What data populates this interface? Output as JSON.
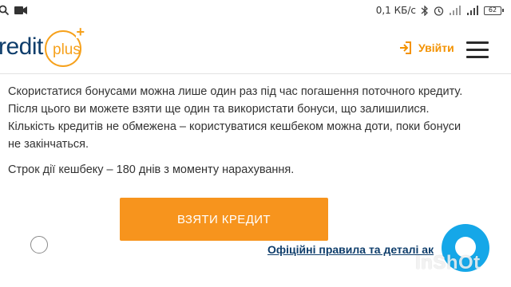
{
  "status_bar": {
    "network_speed": "0,1 КБ/с",
    "battery_level": "62",
    "icons": [
      "search-icon",
      "video-icon",
      "bluetooth-icon",
      "alarm-icon",
      "signal-icon",
      "wifi-icon",
      "battery-icon"
    ]
  },
  "header": {
    "logo_text": "redit",
    "logo_plus_text": "plus",
    "logo_plus_cross": "+",
    "login_label": "Увійти",
    "brand_color": "#0e3d6b",
    "accent_color": "#f6a11c"
  },
  "content": {
    "paragraph_1": "Скористатися бонусами можна лише один раз під час погашення поточного кредиту. Після цього ви можете взяти ще один та використати бонуси, що залишилися. Кількість кредитів не обмежена – користуватися кешбеком можна доти, поки бонуси не закінчаться.",
    "paragraph_2": "Строк дії кешбеку – 180 днів з моменту нарахування."
  },
  "cta": {
    "label": "ВЗЯТИ КРЕДИТ",
    "color": "#f7941d"
  },
  "footer": {
    "rules_link": "Офіційні правила та деталі ак"
  },
  "watermark": {
    "text": "InShOt"
  }
}
